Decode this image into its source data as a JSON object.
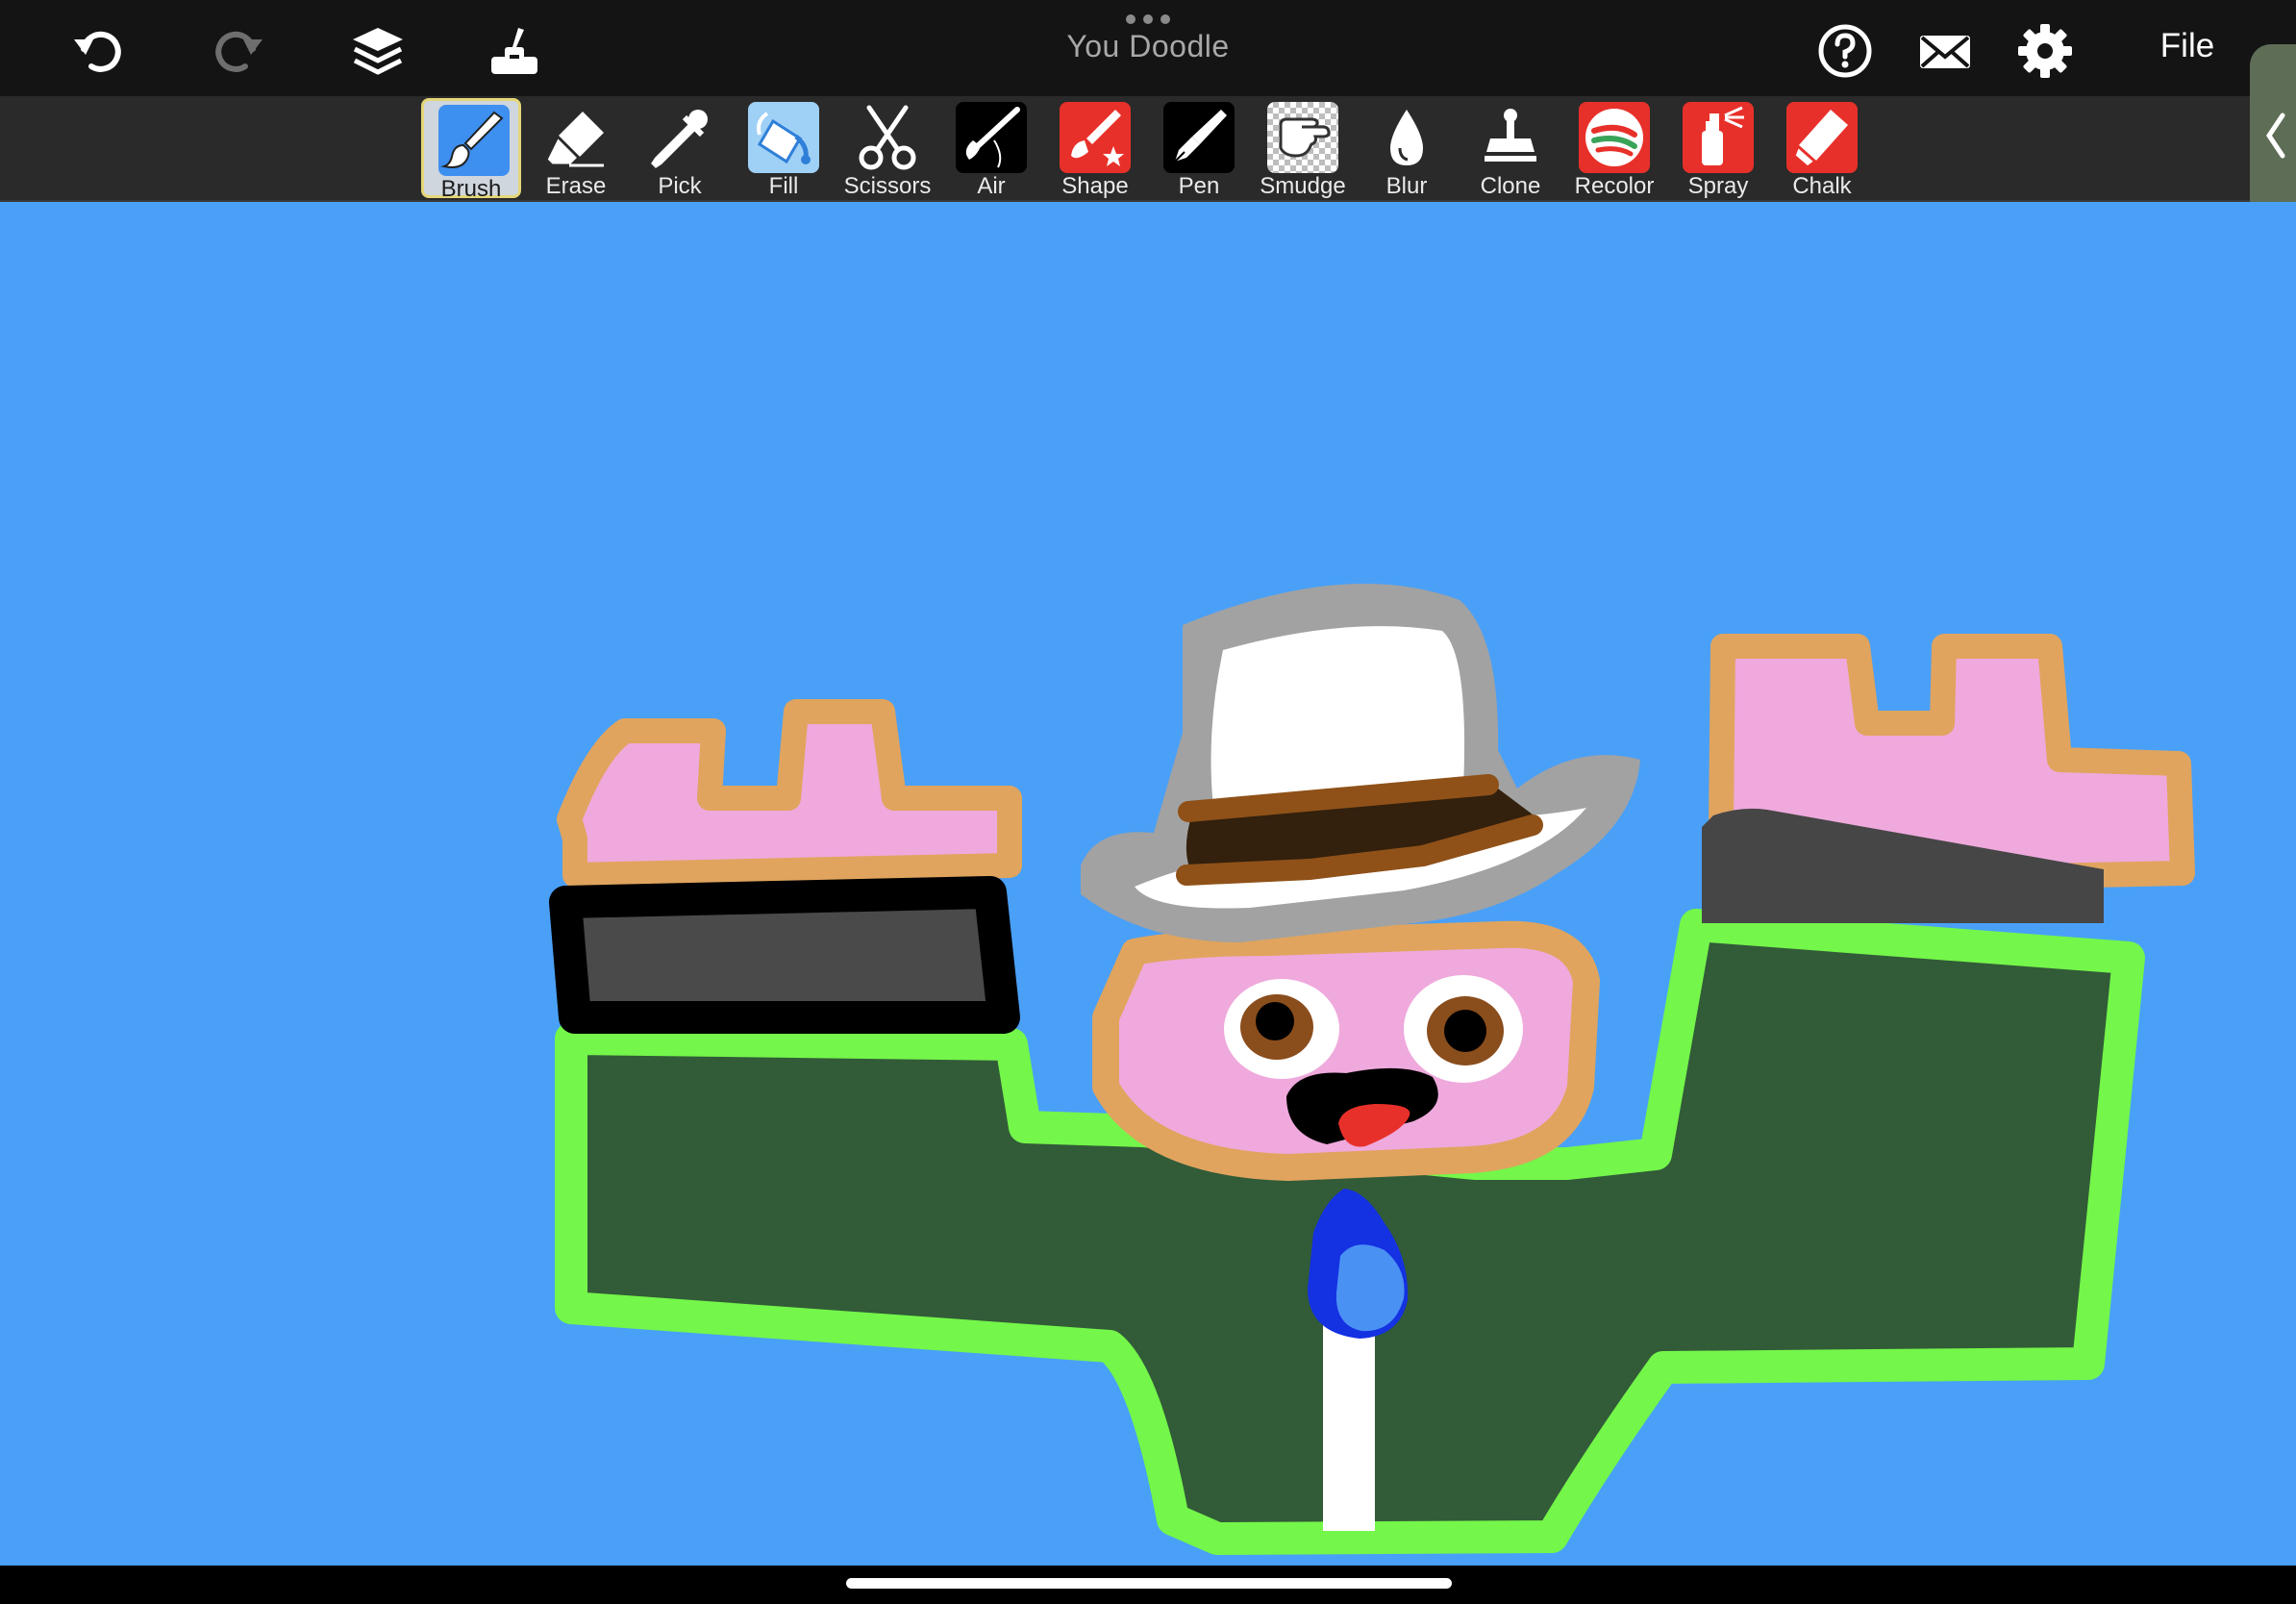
{
  "app": {
    "title": "You Doodle",
    "file_menu": "File"
  },
  "topbar": {
    "left_buttons": [
      "undo-icon",
      "redo-icon",
      "layers-icon",
      "stamp-icon"
    ],
    "right_buttons": [
      "help-icon",
      "mail-icon",
      "gear-icon"
    ]
  },
  "toolbar": {
    "selected": "Brush",
    "tools": [
      {
        "label": "Brush",
        "icon": "brush-icon"
      },
      {
        "label": "Erase",
        "icon": "eraser-icon"
      },
      {
        "label": "Pick",
        "icon": "eyedropper-icon"
      },
      {
        "label": "Fill",
        "icon": "paint-bucket-icon"
      },
      {
        "label": "Scissors",
        "icon": "scissors-icon"
      },
      {
        "label": "Air",
        "icon": "airbrush-icon"
      },
      {
        "label": "Shape",
        "icon": "shape-brush-icon"
      },
      {
        "label": "Pen",
        "icon": "pen-nib-icon"
      },
      {
        "label": "Smudge",
        "icon": "smudge-hand-icon"
      },
      {
        "label": "Blur",
        "icon": "droplet-icon"
      },
      {
        "label": "Clone",
        "icon": "clone-stamp-icon"
      },
      {
        "label": "Recolor",
        "icon": "recolor-icon"
      },
      {
        "label": "Spray",
        "icon": "spray-can-icon"
      },
      {
        "label": "Chalk",
        "icon": "chalk-icon"
      }
    ]
  },
  "colors": {
    "canvas_background": "#4aa0f7",
    "topbar": "#141414",
    "toolbar": "#2a2a2a",
    "selected_tool": "#cfd6dd",
    "red_tool_bg": "#e8302a"
  }
}
